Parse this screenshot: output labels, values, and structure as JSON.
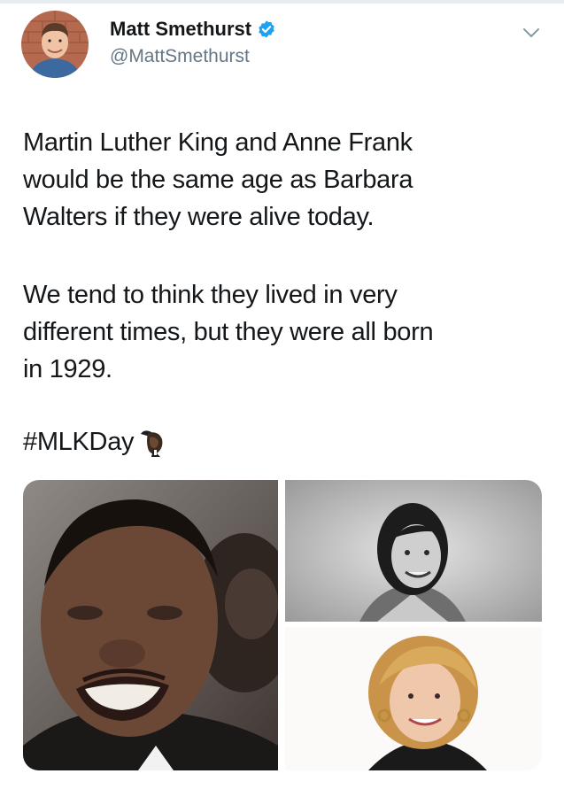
{
  "tweet": {
    "author": {
      "display_name": "Matt Smethurst",
      "handle": "@MattSmethurst",
      "avatar_icon": "profile-photo",
      "verified_icon": "verified-badge-icon",
      "verified_color": "#1da1f2"
    },
    "menu_icon": "chevron-down-icon",
    "paragraphs": [
      {
        "lines": [
          "Martin Luther King and Anne Frank",
          "would be the same age as Barbara",
          "Walters if they were alive today."
        ]
      },
      {
        "lines": [
          "We tend to think they lived in very",
          "different times, but they were all born",
          "in 1929."
        ]
      }
    ],
    "hashtag": "#MLKDay",
    "hashtag_emoji_icon": "mlk-hashflag-emoji-icon",
    "media": {
      "photos": [
        {
          "subject": "Martin Luther King photo"
        },
        {
          "subject": "Anne Frank photo"
        },
        {
          "subject": "Barbara Walters photo"
        }
      ]
    }
  }
}
